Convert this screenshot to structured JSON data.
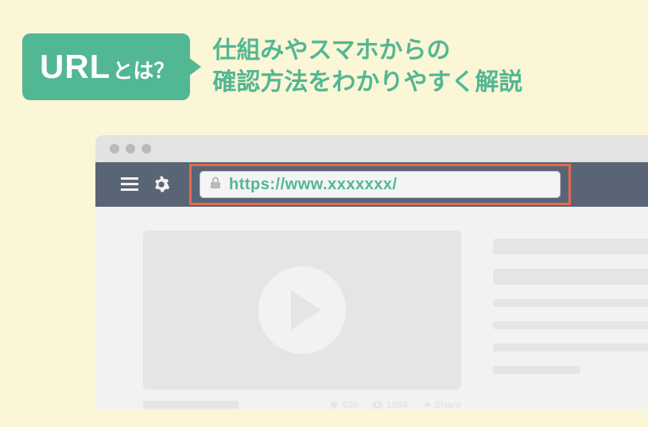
{
  "header": {
    "badge_main": "URL",
    "badge_suffix": "とは？",
    "title_line1": "仕組みやスマホからの",
    "title_line2": "確認方法をわかりやすく解説"
  },
  "browser": {
    "url": "https://www.xxxxxxx/",
    "meta_like": "430",
    "meta_views": "1984",
    "meta_share": "Share"
  }
}
